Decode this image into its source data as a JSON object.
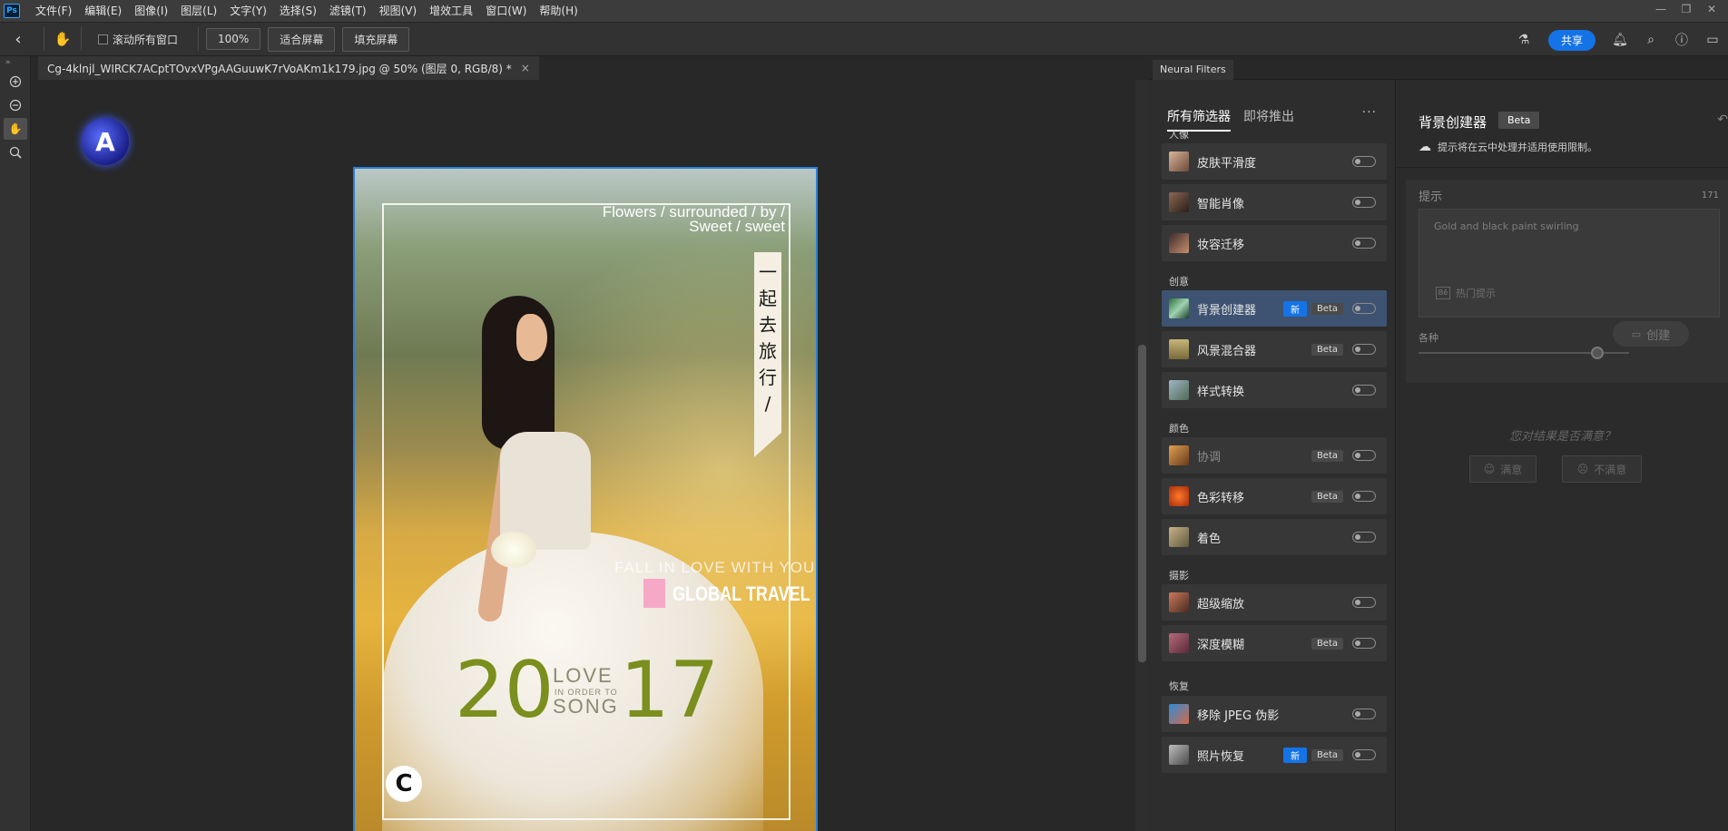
{
  "app": {
    "logo": "Ps"
  },
  "menu": [
    "文件(F)",
    "编辑(E)",
    "图像(I)",
    "图层(L)",
    "文字(Y)",
    "选择(S)",
    "滤镜(T)",
    "视图(V)",
    "增效工具",
    "窗口(W)",
    "帮助(H)"
  ],
  "window_controls": {
    "minimize": "—",
    "restore": "❐",
    "close": "✕"
  },
  "options": {
    "scroll_all": "滚动所有窗口",
    "zoom": "100%",
    "fit_screen": "适合屏幕",
    "fill_screen": "填充屏幕",
    "share": "共享"
  },
  "document": {
    "tab_title": "Cg-4klnjl_WIRCK7ACptTOvxVPgAAGuuwK7rVoAKm1k179.jpg @ 50% (图层 0, RGB/8) *",
    "close": "×"
  },
  "poster": {
    "flowers_line1": "Flowers / surrounded / by /",
    "flowers_line2": "Sweet / sweet",
    "vertical": [
      "一",
      "起",
      "去",
      "旅",
      "行",
      "/"
    ],
    "fall": "FALL IN LOVE WITH YOU",
    "global": "GLOBAL TRAVEL",
    "year_left": "20",
    "year_right": "17",
    "love": "LOVE",
    "in_order": "IN ORDER TO",
    "song": "SONG",
    "badge": "C"
  },
  "neural": {
    "panel_tab": "Neural Filters",
    "subtab_all": "所有筛选器",
    "subtab_soon": "即将推出",
    "more": "···",
    "categories": {
      "portrait": "人像",
      "creative": "创意",
      "color": "颜色",
      "photo": "摄影",
      "restore": "恢复"
    },
    "filters": [
      {
        "name": "皮肤平滑度"
      },
      {
        "name": "智能肖像"
      },
      {
        "name": "妆容迁移"
      },
      {
        "name": "背景创建器",
        "new": "新",
        "beta": "Beta"
      },
      {
        "name": "风景混合器",
        "beta": "Beta"
      },
      {
        "name": "样式转换"
      },
      {
        "name": "协调",
        "beta": "Beta"
      },
      {
        "name": "色彩转移",
        "beta": "Beta"
      },
      {
        "name": "着色"
      },
      {
        "name": "超级缩放"
      },
      {
        "name": "深度模糊",
        "beta": "Beta"
      },
      {
        "name": "移除 JPEG 伪影"
      },
      {
        "name": "照片恢复",
        "new": "新",
        "beta": "Beta"
      }
    ],
    "settings": {
      "title": "背景创建器",
      "beta": "Beta",
      "cloud_note": "提示将在云中处理并适用使用限制。",
      "prompt_label": "提示",
      "prompt_count": "171",
      "prompt_placeholder": "Gold and black paint swirling",
      "hot_icon": "Bē",
      "hot_tip": "热门提示",
      "variety_label": "各种",
      "variety_value": "85",
      "variety_level": 0.85,
      "create": "创建",
      "satisfaction_question": "您对结果是否满意？",
      "satisfied": "满意",
      "unsatisfied": "不满意"
    }
  },
  "colors": {
    "accent": "#1473e6",
    "selected_row": "#3e5371",
    "year_green": "#7a8f1d"
  }
}
